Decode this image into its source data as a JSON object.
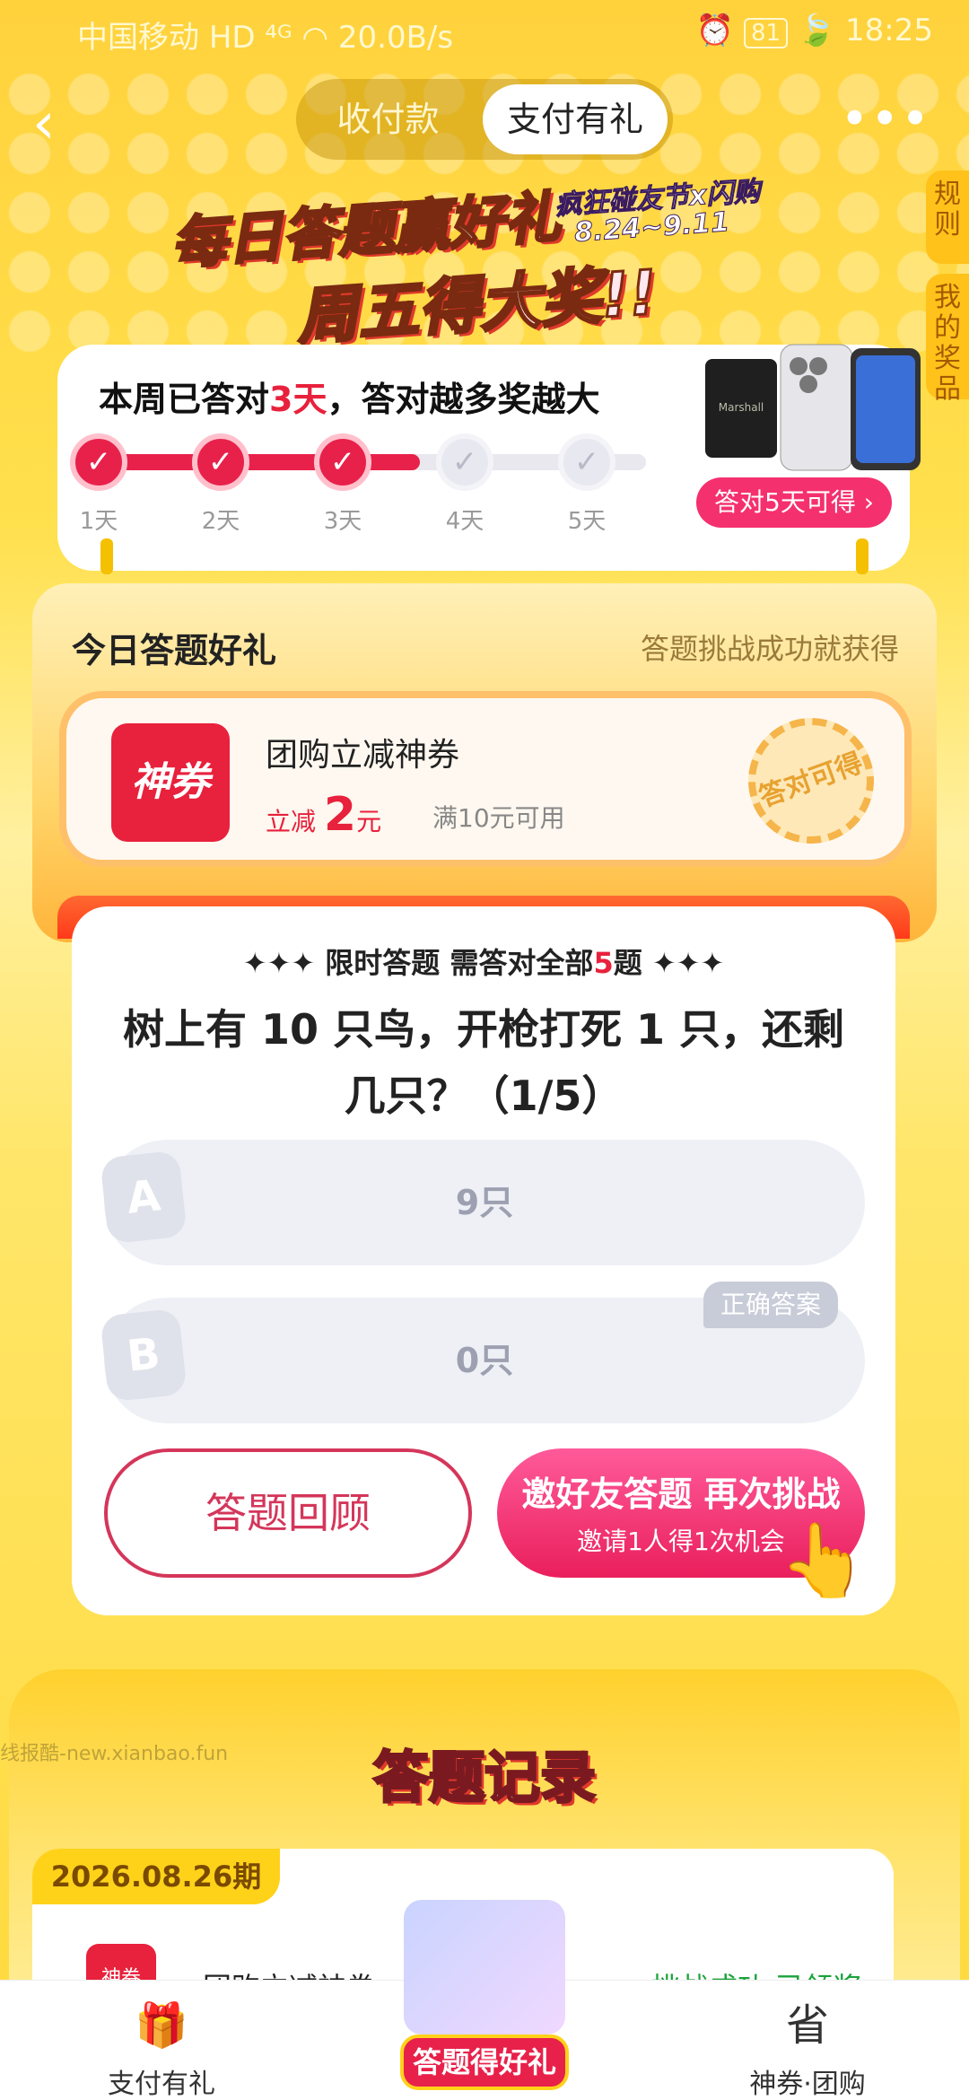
{
  "status_bar": {
    "carrier": "中国移动",
    "network": "HD ⁴ᴳ",
    "speed": "20.0B/s",
    "battery": "81",
    "time": "18:25"
  },
  "nav": {
    "back_icon": "chevron-left-icon",
    "tabs": [
      "收付款",
      "支付有礼"
    ],
    "active_tab": "支付有礼",
    "more_icon": "more-dots-icon"
  },
  "side_tabs": [
    "规则",
    "我的奖品"
  ],
  "banner": {
    "title_line1": "每日答题赢好礼",
    "title_line2": "周五得大奖!!",
    "collab": "疯狂碰友节x闪购",
    "dates": "8.24~9.11"
  },
  "progress": {
    "title_prefix": "本周已答对",
    "title_count": "3天",
    "title_suffix": "，答对越多奖越大",
    "days": [
      "1天",
      "2天",
      "3天",
      "4天",
      "5天"
    ],
    "completed": 3,
    "reward_button": "答对5天可得 ›"
  },
  "gift": {
    "title": "今日答题好礼",
    "subtitle": "答题挑战成功就获得",
    "coupon_icon_text": "神券",
    "coupon_name": "团购立减神券",
    "discount_prefix": "立减",
    "discount_amount": "2",
    "discount_unit": "元",
    "condition": "满10元可用",
    "stamp": "答对可得"
  },
  "quiz": {
    "header_prefix": "✦✦✦ 限时答题 需答对全部",
    "header_count": "5",
    "header_suffix": "题 ✦✦✦",
    "question": "树上有 10 只鸟，开枪打死 1 只，还剩几只？（1/5）",
    "options": [
      {
        "letter": "A",
        "text": "9只"
      },
      {
        "letter": "B",
        "text": "0只"
      }
    ],
    "correct_tag": "正确答案",
    "review_button": "答题回顾",
    "invite_main": "邀好友答题 再次挑战",
    "invite_sub": "邀请1人得1次机会"
  },
  "records": {
    "title": "答题记录",
    "watermark": "线报酷-new.xianbao.fun",
    "date": "2026.08.26期",
    "icon_text": "神券",
    "item_name": "团购立减神券",
    "status": "挑战成功,已领奖"
  },
  "bottom_nav": {
    "left_label": "支付有礼",
    "center_label": "答题得好礼",
    "right_label": "神券·团购",
    "left_icon": "gift-box-icon",
    "right_icon": "save-coupon-icon"
  }
}
